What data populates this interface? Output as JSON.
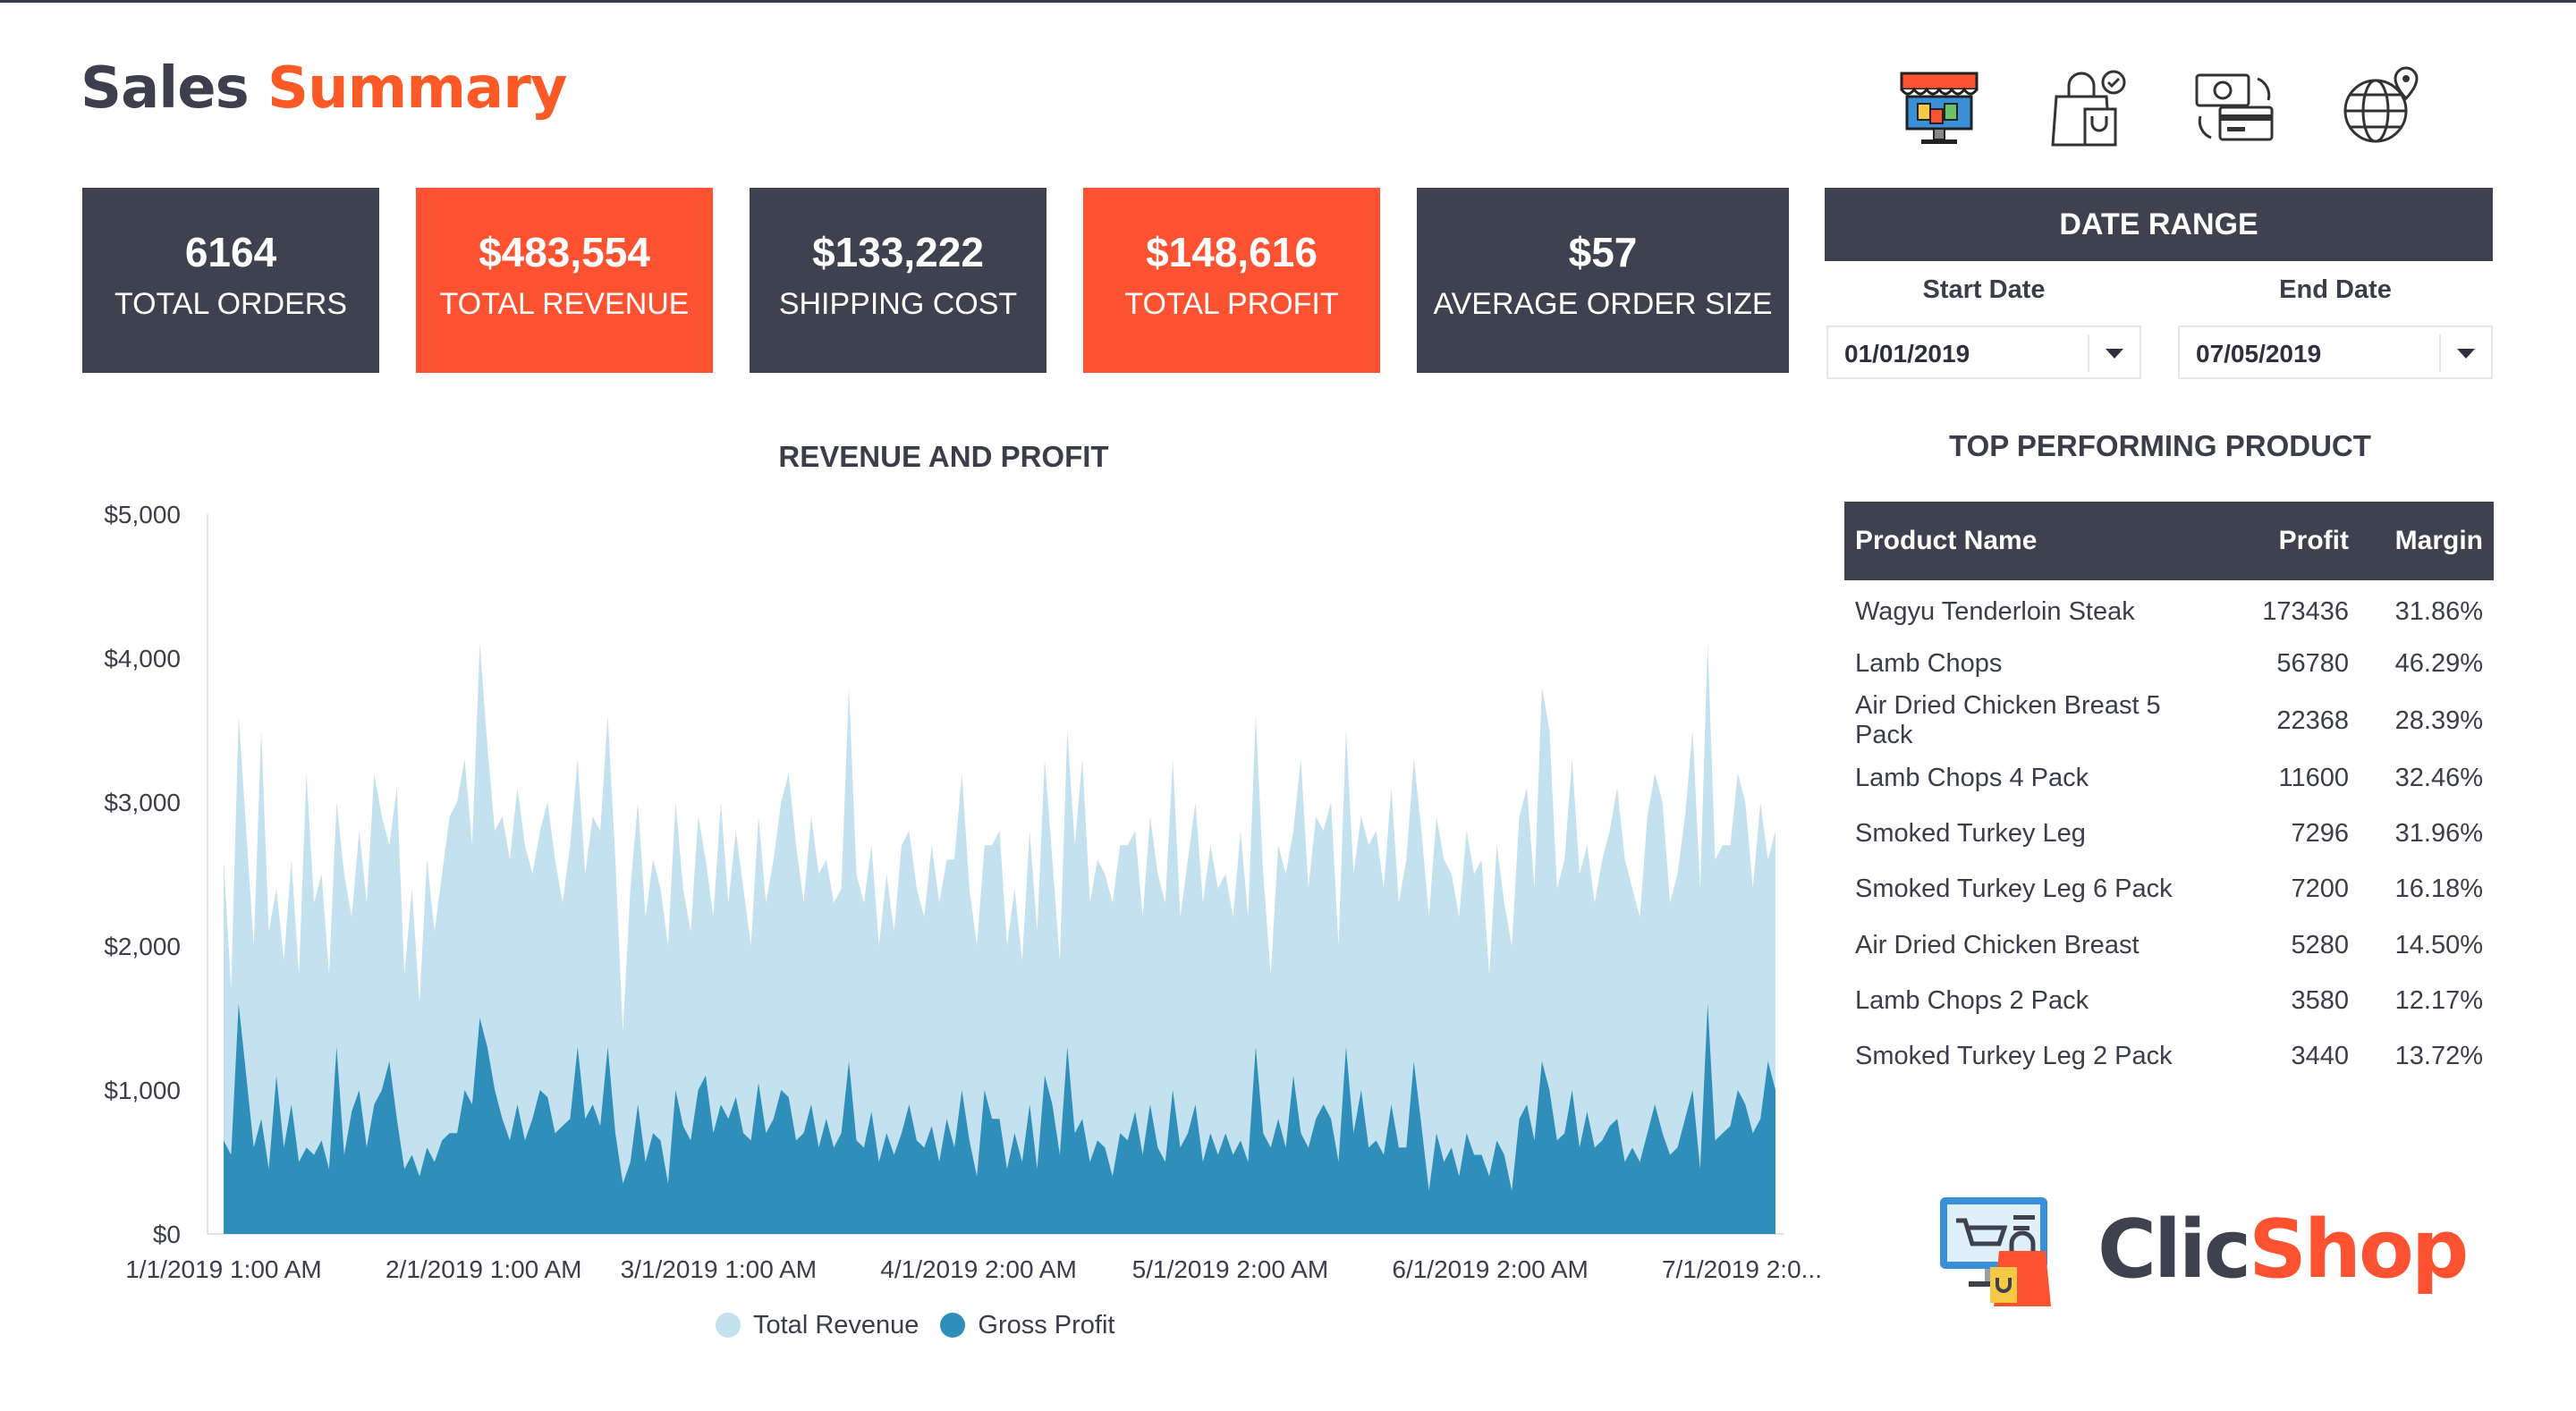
{
  "header": {
    "title_part1": "Sales",
    "title_part2": "Summary",
    "icons": [
      "storefront-icon",
      "shopping-bag-check-icon",
      "payment-exchange-icon",
      "global-location-icon"
    ]
  },
  "kpis": [
    {
      "value": "6164",
      "label": "TOTAL ORDERS",
      "color": "#3e414e"
    },
    {
      "value": "$483,554",
      "label": "TOTAL REVENUE",
      "color": "#fd5231"
    },
    {
      "value": "$133,222",
      "label": "SHIPPING COST",
      "color": "#3e414e"
    },
    {
      "value": "$148,616",
      "label": "TOTAL PROFIT",
      "color": "#fd5231"
    },
    {
      "value": "$57",
      "label": "AVERAGE ORDER SIZE",
      "color": "#3e414e"
    }
  ],
  "date_range": {
    "title": "DATE RANGE",
    "start_label": "Start Date",
    "start_value": "01/01/2019",
    "end_label": "End Date",
    "end_value": "07/05/2019"
  },
  "chart_data": {
    "type": "area",
    "title": "REVENUE AND PROFIT",
    "xlabel": "",
    "ylabel": "",
    "ylim": [
      0,
      5000
    ],
    "y_ticks": [
      "$0",
      "$1,000",
      "$2,000",
      "$3,000",
      "$4,000",
      "$5,000"
    ],
    "x_ticks": [
      "1/1/2019 1:00 AM",
      "2/1/2019 1:00 AM",
      "3/1/2019 1:00 AM",
      "4/1/2019 2:00 AM",
      "5/1/2019 2:00 AM",
      "6/1/2019 2:00 AM",
      "7/1/2019 2:0..."
    ],
    "x_range": [
      "2019-01-01",
      "2019-07-05"
    ],
    "legend_position": "bottom",
    "series": [
      {
        "name": "Total Revenue",
        "color": "#c3e1ee",
        "values": [
          2600,
          1700,
          3600,
          2800,
          2000,
          3500,
          2100,
          2400,
          1900,
          2600,
          1800,
          3200,
          2300,
          2500,
          1800,
          3000,
          2500,
          2200,
          2800,
          2300,
          3200,
          2900,
          2700,
          3100,
          1800,
          2400,
          1600,
          2600,
          2100,
          2500,
          2900,
          3000,
          3300,
          2700,
          4100,
          3400,
          2800,
          2900,
          2600,
          3100,
          2700,
          2500,
          2800,
          3000,
          2600,
          2300,
          2700,
          3300,
          2500,
          2900,
          2800,
          3600,
          2600,
          1400,
          2400,
          3000,
          2200,
          2600,
          2400,
          2000,
          3000,
          2400,
          2100,
          2900,
          2600,
          2200,
          3000,
          2300,
          2800,
          2400,
          2000,
          2900,
          2300,
          2600,
          3000,
          3200,
          2700,
          2300,
          2900,
          2500,
          2600,
          2300,
          2400,
          3800,
          2500,
          2300,
          2700,
          2000,
          2500,
          2100,
          2700,
          2800,
          2400,
          2200,
          2700,
          2300,
          2600,
          2600,
          3200,
          2400,
          2000,
          2700,
          2700,
          2800,
          2000,
          2400,
          1900,
          2800,
          2100,
          3300,
          2600,
          1900,
          3500,
          2700,
          3300,
          2300,
          2600,
          2500,
          2300,
          2700,
          2700,
          2800,
          2200,
          2900,
          2500,
          2300,
          3300,
          2200,
          2600,
          3000,
          2300,
          2700,
          2400,
          2500,
          2200,
          2800,
          2200,
          3600,
          2500,
          1800,
          2700,
          2500,
          2800,
          3300,
          2400,
          2900,
          2800,
          3000,
          2000,
          3500,
          2500,
          2900,
          2700,
          2800,
          2400,
          3100,
          2300,
          2600,
          3300,
          2800,
          2200,
          2900,
          2600,
          2500,
          2200,
          2800,
          2500,
          2600,
          1800,
          2700,
          2300,
          2000,
          2900,
          3100,
          2400,
          3800,
          3500,
          2400,
          2600,
          3300,
          2500,
          2700,
          2300,
          2600,
          2800,
          3100,
          2600,
          2400,
          2200,
          2900,
          3200,
          3000,
          2300,
          2500,
          2900,
          3500,
          2400,
          4100,
          2600,
          2700,
          2700,
          3200,
          3000,
          2400,
          3000,
          2600,
          2800
        ]
      },
      {
        "name": "Gross Profit",
        "color": "#2f8fba",
        "values": [
          650,
          550,
          1600,
          1100,
          600,
          800,
          450,
          1100,
          600,
          900,
          500,
          600,
          550,
          650,
          450,
          1300,
          550,
          850,
          1000,
          600,
          900,
          1000,
          1200,
          800,
          450,
          550,
          400,
          600,
          500,
          650,
          700,
          700,
          1000,
          900,
          1500,
          1300,
          1000,
          800,
          650,
          900,
          650,
          800,
          1000,
          950,
          700,
          750,
          800,
          1300,
          800,
          900,
          750,
          1300,
          700,
          350,
          500,
          900,
          500,
          700,
          650,
          350,
          1000,
          750,
          650,
          1000,
          1100,
          700,
          900,
          800,
          950,
          700,
          650,
          1050,
          700,
          800,
          1000,
          950,
          650,
          700,
          900,
          600,
          800,
          600,
          700,
          1200,
          650,
          600,
          850,
          500,
          700,
          550,
          700,
          900,
          650,
          600,
          750,
          500,
          800,
          600,
          1000,
          650,
          400,
          1000,
          800,
          800,
          450,
          700,
          500,
          900,
          450,
          1100,
          900,
          550,
          1300,
          700,
          800,
          500,
          650,
          600,
          400,
          700,
          650,
          850,
          550,
          900,
          600,
          500,
          1000,
          600,
          700,
          900,
          500,
          700,
          550,
          700,
          550,
          650,
          500,
          1300,
          700,
          600,
          800,
          600,
          1100,
          700,
          600,
          800,
          900,
          800,
          500,
          1300,
          700,
          1000,
          600,
          650,
          550,
          900,
          600,
          600,
          1200,
          750,
          300,
          700,
          500,
          600,
          400,
          700,
          550,
          550,
          400,
          650,
          550,
          300,
          800,
          900,
          650,
          1200,
          1000,
          650,
          700,
          1000,
          600,
          850,
          600,
          650,
          750,
          800,
          500,
          600,
          500,
          700,
          900,
          700,
          550,
          600,
          800,
          1000,
          450,
          1600,
          650,
          700,
          750,
          1000,
          900,
          700,
          800,
          1200,
          1000
        ]
      }
    ]
  },
  "top_products": {
    "title": "TOP PERFORMING PRODUCT",
    "columns": [
      "Product Name",
      "Profit",
      "Margin"
    ],
    "rows": [
      [
        "Wagyu Tenderloin Steak",
        "173436",
        "31.86%"
      ],
      [
        "Lamb Chops",
        "56780",
        "46.29%"
      ],
      [
        "Air Dried Chicken Breast 5 Pack",
        "22368",
        "28.39%"
      ],
      [
        "Lamb Chops 4 Pack",
        "11600",
        "32.46%"
      ],
      [
        "Smoked Turkey Leg",
        "7296",
        "31.96%"
      ],
      [
        "Smoked Turkey Leg 6 Pack",
        "7200",
        "16.18%"
      ],
      [
        "Air Dried Chicken Breast",
        "5280",
        "14.50%"
      ],
      [
        "Lamb Chops 2 Pack",
        "3580",
        "12.17%"
      ],
      [
        "Smoked Turkey Leg 2 Pack",
        "3440",
        "13.72%"
      ]
    ]
  },
  "brand": {
    "name_part1": "Clic",
    "name_part2": "Shop",
    "icon": "shop-screen-bag-icon"
  }
}
